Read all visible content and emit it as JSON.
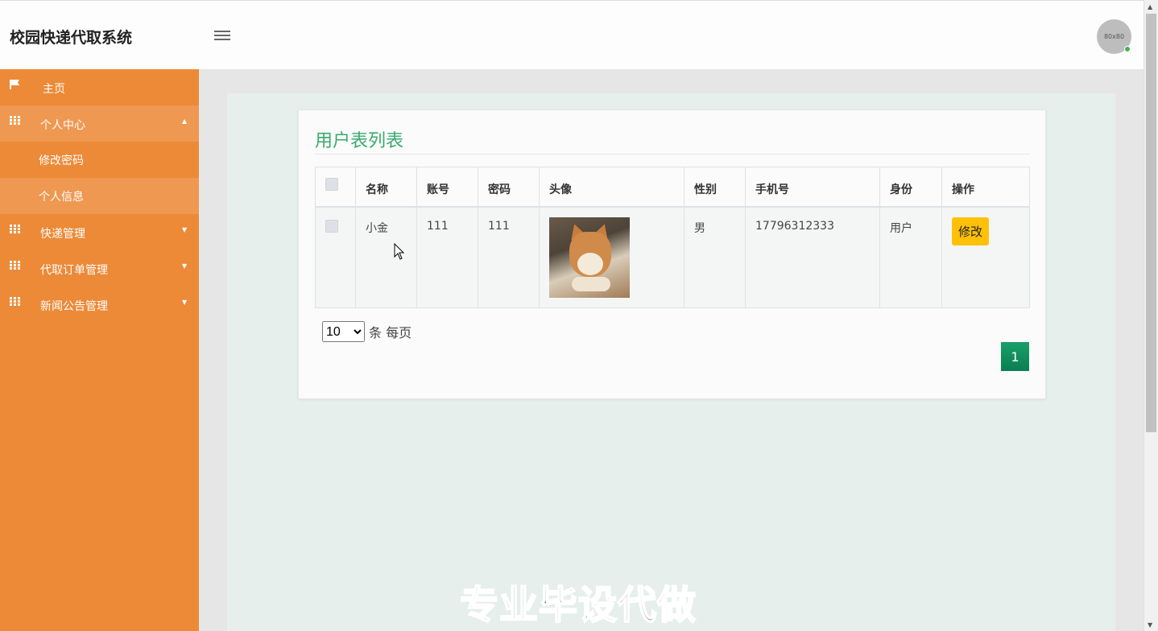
{
  "header": {
    "title": "校园快递代取系统",
    "menu_icon": "hamburger-icon",
    "avatar_text": "80x80"
  },
  "sidebar": {
    "items": [
      {
        "label": "主页",
        "icon": "flag-icon"
      },
      {
        "label": "个人中心",
        "icon": "grid-icon",
        "expanded": true,
        "children": [
          {
            "label": "修改密码"
          },
          {
            "label": "个人信息"
          }
        ]
      },
      {
        "label": "快递管理",
        "icon": "grid-icon"
      },
      {
        "label": "代取订单管理",
        "icon": "grid-icon"
      },
      {
        "label": "新闻公告管理",
        "icon": "grid-icon"
      }
    ]
  },
  "main": {
    "title": "用户表列表",
    "table": {
      "columns": [
        "名称",
        "账号",
        "密码",
        "头像",
        "性别",
        "手机号",
        "身份",
        "操作"
      ],
      "rows": [
        {
          "name": "小金",
          "account": "111",
          "password": "111",
          "gender": "男",
          "phone": "17796312333",
          "role": "用户",
          "action": "修改"
        }
      ]
    },
    "pager": {
      "page_size": "10",
      "page_size_suffix": "条 每页",
      "current_page": "1"
    }
  },
  "watermark": "专业毕设代做",
  "colors": {
    "sidebar": "#ec8a38",
    "title_green": "#3aaa6e",
    "edit_button": "#ffc107",
    "page_button": "#129065"
  }
}
